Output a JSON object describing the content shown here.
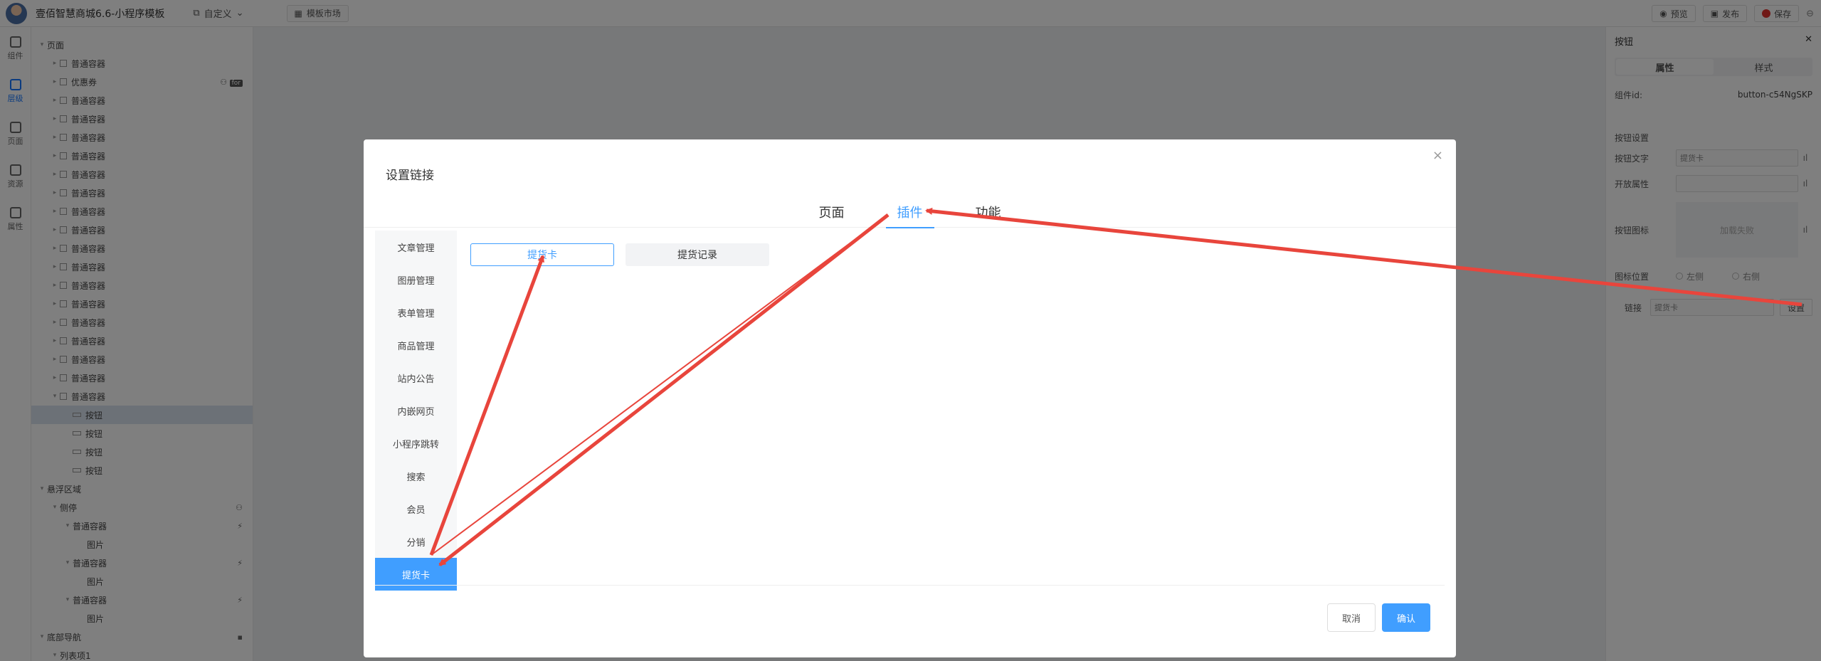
{
  "topbar": {
    "app_title": "壹佰智慧商城6.6-小程序模板",
    "custom_label": "自定义",
    "market_label": "模板市场",
    "preview_label": "预览",
    "publish_label": "发布",
    "save_label": "保存"
  },
  "rail": [
    {
      "label": "组件",
      "active": false
    },
    {
      "label": "层级",
      "active": true
    },
    {
      "label": "页面",
      "active": false
    },
    {
      "label": "资源",
      "active": false
    },
    {
      "label": "属性",
      "active": false
    }
  ],
  "tree": {
    "root": "页面",
    "containers": [
      "普通容器",
      "优惠券",
      "普通容器",
      "普通容器",
      "普通容器",
      "普通容器",
      "普通容器",
      "普通容器",
      "普通容器",
      "普通容器",
      "普通容器",
      "普通容器",
      "普通容器",
      "普通容器",
      "普通容器",
      "普通容器",
      "普通容器",
      "普通容器",
      "普通容器"
    ],
    "buttons": [
      "按钮",
      "按钮",
      "按钮",
      "按钮"
    ],
    "float_area": "悬浮区域",
    "side": "侧停",
    "float_children": [
      "普通容器",
      "图片",
      "普通容器",
      "图片",
      "普通容器",
      "图片"
    ],
    "bottom_nav": "底部导航",
    "list_item": "列表项1",
    "coupon_badge": "for"
  },
  "right_panel": {
    "title": "按钮",
    "tab_attr": "属性",
    "tab_style": "样式",
    "id_label": "组件id:",
    "id_value": "button-c54NgSKP",
    "section_title": "按钮设置",
    "text_label": "按钮文字",
    "text_value": "提货卡",
    "open_attr_label": "开放属性",
    "icon_label": "按钮图标",
    "icon_placeholder": "加载失败",
    "icon_pos_label": "图标位置",
    "pos_left": "左侧",
    "pos_right": "右侧",
    "link_label": "链接",
    "link_value": "提货卡",
    "set_label": "设置"
  },
  "modal": {
    "title": "设置链接",
    "tabs": [
      {
        "label": "页面",
        "active": false
      },
      {
        "label": "插件",
        "active": true
      },
      {
        "label": "功能",
        "active": false
      }
    ],
    "categories": [
      {
        "label": "文章管理",
        "active": false
      },
      {
        "label": "图册管理",
        "active": false
      },
      {
        "label": "表单管理",
        "active": false
      },
      {
        "label": "商品管理",
        "active": false
      },
      {
        "label": "站内公告",
        "active": false
      },
      {
        "label": "内嵌网页",
        "active": false
      },
      {
        "label": "小程序跳转",
        "active": false
      },
      {
        "label": "搜索",
        "active": false
      },
      {
        "label": "会员",
        "active": false
      },
      {
        "label": "分销",
        "active": false
      },
      {
        "label": "提货卡",
        "active": true
      }
    ],
    "options": [
      {
        "label": "提货卡",
        "active": true
      },
      {
        "label": "提货记录",
        "active": false
      }
    ],
    "cancel_label": "取消",
    "ok_label": "确认"
  },
  "colors": {
    "accent": "#409eff",
    "annotation": "#e8453c"
  }
}
